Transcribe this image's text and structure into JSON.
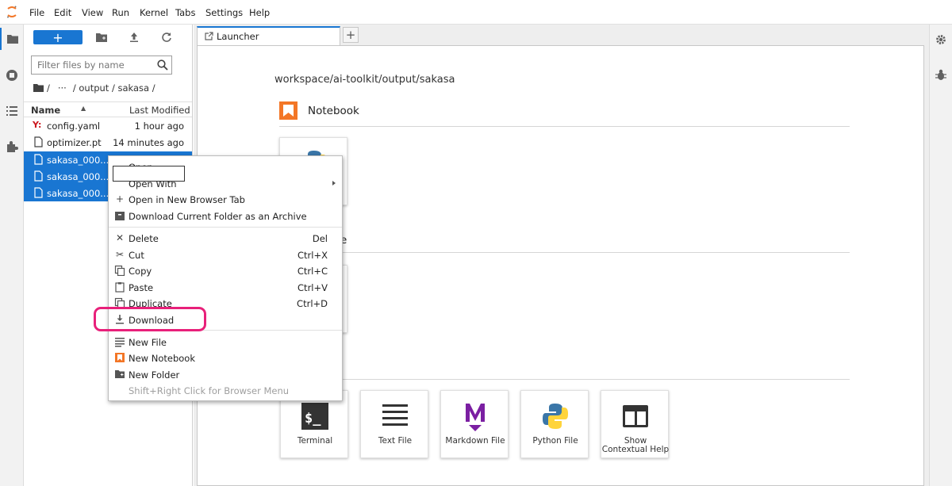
{
  "menubar": {
    "items": [
      "File",
      "Edit",
      "View",
      "Run",
      "Kernel",
      "Tabs",
      "Settings",
      "Help"
    ]
  },
  "filebrowser": {
    "new_button_label": "+",
    "search_placeholder": "Filter files by name",
    "breadcrumb": {
      "sep1": "/",
      "ellipsis": "···",
      "path": "/ output / sakasa /"
    },
    "headers": {
      "name": "Name",
      "sort_arrow": "▲",
      "modified": "Last Modified"
    },
    "files": [
      {
        "name": "config.yaml",
        "modified": "1 hour ago"
      },
      {
        "name": "optimizer.pt",
        "modified": "14 minutes ago"
      },
      {
        "name": "sakasa_000..."
      },
      {
        "name": "sakasa_000..."
      },
      {
        "name": "sakasa_000..."
      }
    ]
  },
  "tabs": {
    "launcher_label": "Launcher",
    "add_label": "+"
  },
  "launcher": {
    "cwd": "workspace/ai-toolkit/output/sakasa",
    "notebook_section": "Notebook",
    "console_section_partial": "e",
    "other_cards": [
      "Terminal",
      "Text File",
      "Markdown File",
      "Python File",
      "Show Contextual Help"
    ]
  },
  "context_menu": {
    "open": "Open",
    "open_with": "Open With",
    "open_new_tab": "Open in New Browser Tab",
    "download_archive": "Download Current Folder as an Archive",
    "delete": {
      "label": "Delete",
      "shortcut": "Del"
    },
    "cut": {
      "label": "Cut",
      "shortcut": "Ctrl+X"
    },
    "copy": {
      "label": "Copy",
      "shortcut": "Ctrl+C"
    },
    "paste": {
      "label": "Paste",
      "shortcut": "Ctrl+V"
    },
    "duplicate": {
      "label": "Duplicate",
      "shortcut": "Ctrl+D"
    },
    "download": "Download",
    "new_file": "New File",
    "new_notebook": "New Notebook",
    "new_folder": "New Folder",
    "hint": "Shift+Right Click for Browser Menu"
  },
  "colors": {
    "accent": "#1976d2",
    "highlight": "#e8207a",
    "jupyter_orange": "#f37626"
  }
}
